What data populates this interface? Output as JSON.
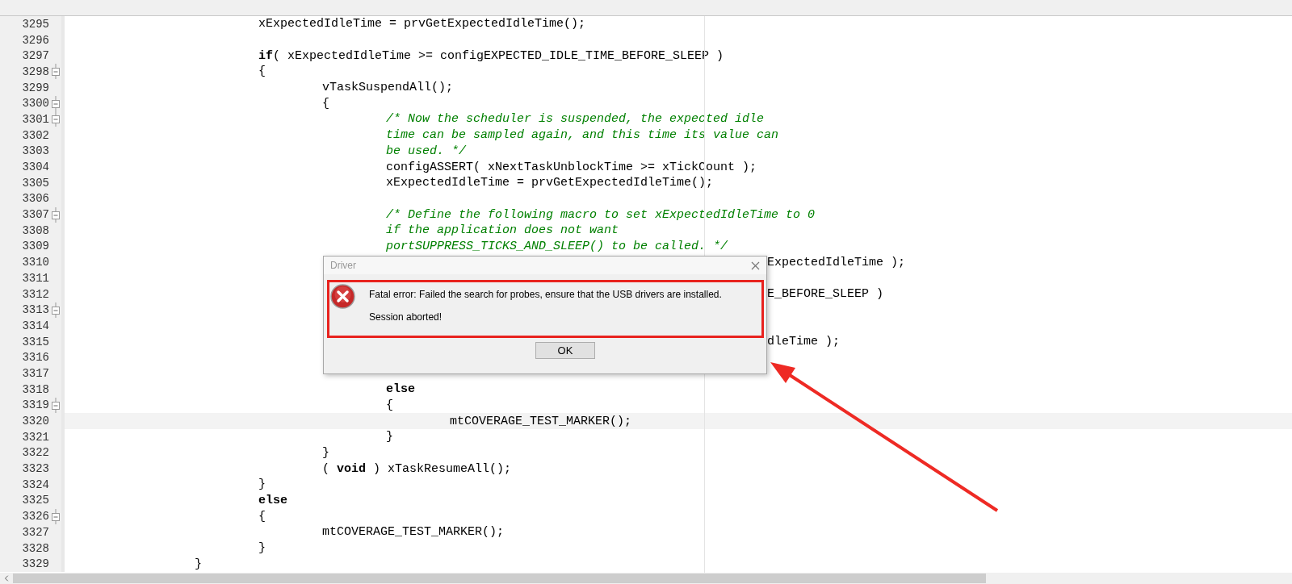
{
  "editor": {
    "lines": [
      {
        "number": "3295",
        "fold": false,
        "current": false,
        "kind": "code",
        "text": "\t\t\txExpectedIdleTime = prvGetExpectedIdleTime();"
      },
      {
        "number": "3296",
        "fold": false,
        "current": false
      },
      {
        "number": "3297",
        "fold": false,
        "current": false,
        "kind": "code",
        "text": "\t\t\t**if**( xExpectedIdleTime >= configEXPECTED_IDLE_TIME_BEFORE_SLEEP )"
      },
      {
        "number": "3298",
        "fold": true,
        "current": false,
        "kind": "code",
        "text": "\t\t\t{"
      },
      {
        "number": "3299",
        "fold": false,
        "current": false,
        "kind": "code",
        "text": "\t\t\t\tvTaskSuspendAll();"
      },
      {
        "number": "3300",
        "fold": true,
        "current": false,
        "kind": "code",
        "text": "\t\t\t\t{"
      },
      {
        "number": "3301",
        "fold": true,
        "current": false,
        "kind": "comment",
        "text": "\t\t\t\t\t/* Now the scheduler is suspended, the expected idle"
      },
      {
        "number": "3302",
        "fold": false,
        "current": false,
        "kind": "comment",
        "text": "\t\t\t\t\ttime can be sampled again, and this time its value can"
      },
      {
        "number": "3303",
        "fold": false,
        "current": false,
        "kind": "comment",
        "text": "\t\t\t\t\tbe used. */"
      },
      {
        "number": "3304",
        "fold": false,
        "current": false,
        "kind": "code",
        "text": "\t\t\t\t\tconfigASSERT( xNextTaskUnblockTime >= xTickCount );"
      },
      {
        "number": "3305",
        "fold": false,
        "current": false,
        "kind": "code",
        "text": "\t\t\t\t\txExpectedIdleTime = prvGetExpectedIdleTime();"
      },
      {
        "number": "3306",
        "fold": false,
        "current": false
      },
      {
        "number": "3307",
        "fold": true,
        "current": false,
        "kind": "comment",
        "text": "\t\t\t\t\t/* Define the following macro to set xExpectedIdleTime to 0"
      },
      {
        "number": "3308",
        "fold": false,
        "current": false,
        "kind": "comment",
        "text": "\t\t\t\t\tif the application does not want"
      },
      {
        "number": "3309",
        "fold": false,
        "current": false,
        "kind": "comment",
        "text": "\t\t\t\t\tportSUPPRESS_TICKS_AND_SLEEP() to be called. */"
      },
      {
        "number": "3310",
        "fold": false,
        "current": false,
        "kind": "fragment",
        "text": "ExpectedIdleTime );"
      },
      {
        "number": "3311",
        "fold": false,
        "current": false
      },
      {
        "number": "3312",
        "fold": false,
        "current": false,
        "kind": "fragment",
        "text": "E_BEFORE_SLEEP )"
      },
      {
        "number": "3313",
        "fold": true,
        "current": false
      },
      {
        "number": "3314",
        "fold": false,
        "current": false
      },
      {
        "number": "3315",
        "fold": false,
        "current": false,
        "kind": "fragment",
        "text": "dleTime );"
      },
      {
        "number": "3316",
        "fold": false,
        "current": false
      },
      {
        "number": "3317",
        "fold": false,
        "current": false
      },
      {
        "number": "3318",
        "fold": false,
        "current": false,
        "kind": "code",
        "text": "\t\t\t\t\t**else**"
      },
      {
        "number": "3319",
        "fold": true,
        "current": false,
        "kind": "code",
        "text": "\t\t\t\t\t{"
      },
      {
        "number": "3320",
        "fold": false,
        "current": true,
        "kind": "code",
        "text": "\t\t\t\t\t\tmtCOVERAGE_TEST_MARKER();"
      },
      {
        "number": "3321",
        "fold": false,
        "current": false,
        "kind": "code",
        "text": "\t\t\t\t\t}"
      },
      {
        "number": "3322",
        "fold": false,
        "current": false,
        "kind": "code",
        "text": "\t\t\t\t}"
      },
      {
        "number": "3323",
        "fold": false,
        "current": false,
        "kind": "code",
        "text": "\t\t\t\t( **void** ) xTaskResumeAll();"
      },
      {
        "number": "3324",
        "fold": false,
        "current": false,
        "kind": "code",
        "text": "\t\t\t}"
      },
      {
        "number": "3325",
        "fold": false,
        "current": false,
        "kind": "code",
        "text": "\t\t\t**else**"
      },
      {
        "number": "3326",
        "fold": true,
        "current": false,
        "kind": "code",
        "text": "\t\t\t{"
      },
      {
        "number": "3327",
        "fold": false,
        "current": false,
        "kind": "code",
        "text": "\t\t\t\tmtCOVERAGE_TEST_MARKER();"
      },
      {
        "number": "3328",
        "fold": false,
        "current": false,
        "kind": "code",
        "text": "\t\t\t}"
      },
      {
        "number": "3329",
        "fold": false,
        "current": false,
        "kind": "code",
        "text": "\t\t}"
      }
    ]
  },
  "dialog": {
    "title": "Driver",
    "message": "Fatal error: Failed the search for probes, ensure that the USB drivers are installed.",
    "detail": "Session aborted!",
    "button": "OK"
  }
}
